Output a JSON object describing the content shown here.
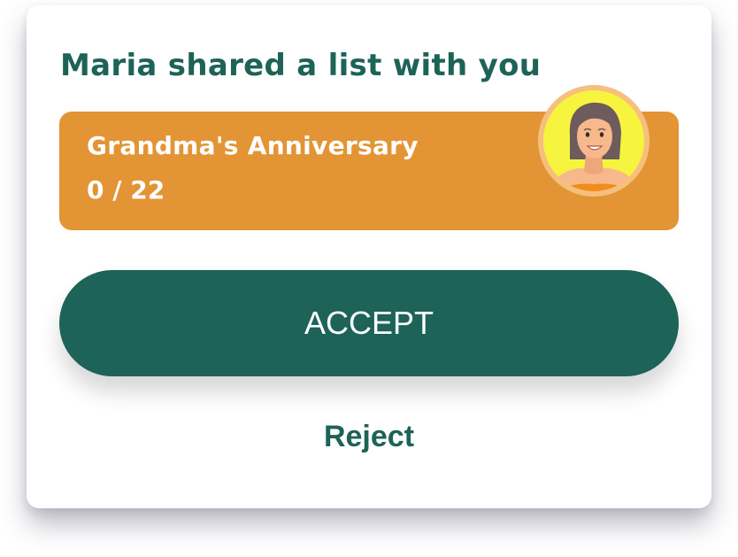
{
  "dialog": {
    "title": "Maria shared a list with you"
  },
  "shared_list": {
    "name": "Grandma's Anniversary",
    "progress": "0 / 22",
    "color": "#e39434",
    "avatar_icon": "woman-avatar-icon"
  },
  "actions": {
    "accept_label": "ACCEPT",
    "reject_label": "Reject"
  },
  "colors": {
    "primary": "#1d6357",
    "avatar_background": "#f6f43e",
    "avatar_ring": "#f5c07e"
  }
}
